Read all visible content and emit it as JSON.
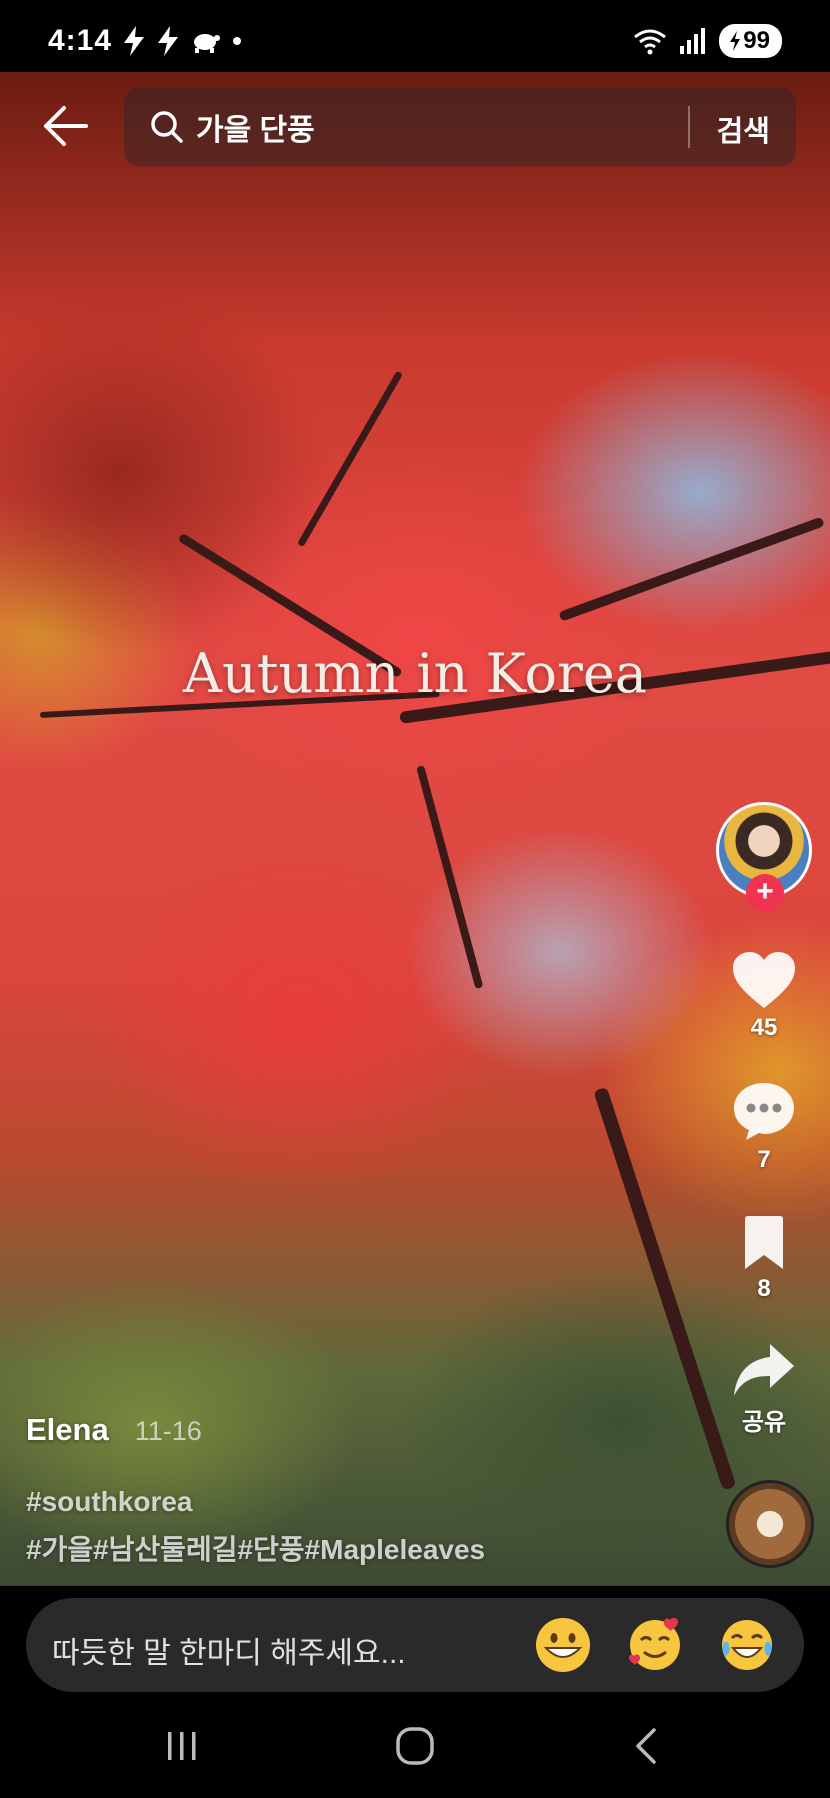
{
  "status_bar": {
    "time": "4:14",
    "battery": "99",
    "icons": [
      "flash-icon",
      "flash-icon",
      "turtle-icon",
      "dot-icon",
      "wifi-icon",
      "signal-icon"
    ]
  },
  "search": {
    "query": "가을 단풍",
    "submit_label": "검색"
  },
  "video": {
    "overlay_title": "Autumn in Korea"
  },
  "actions": {
    "follow_symbol": "+",
    "likes": "45",
    "comments": "7",
    "bookmarks": "8",
    "share_label": "공유"
  },
  "caption": {
    "author": "Elena",
    "date": "11-16",
    "hashtags_line1": "#southkorea",
    "hashtags_line2": "#가을#남산둘레길#단풍#Mapleleaves"
  },
  "comment_bar": {
    "placeholder": "따듯한 말 한마디 해주세요...",
    "emojis": [
      "grinning-face",
      "smiling-face-with-hearts",
      "tears-of-joy-face"
    ]
  },
  "colors": {
    "follow_badge": "#f0334f",
    "comment_bar_bg": "#2a2a2a"
  }
}
